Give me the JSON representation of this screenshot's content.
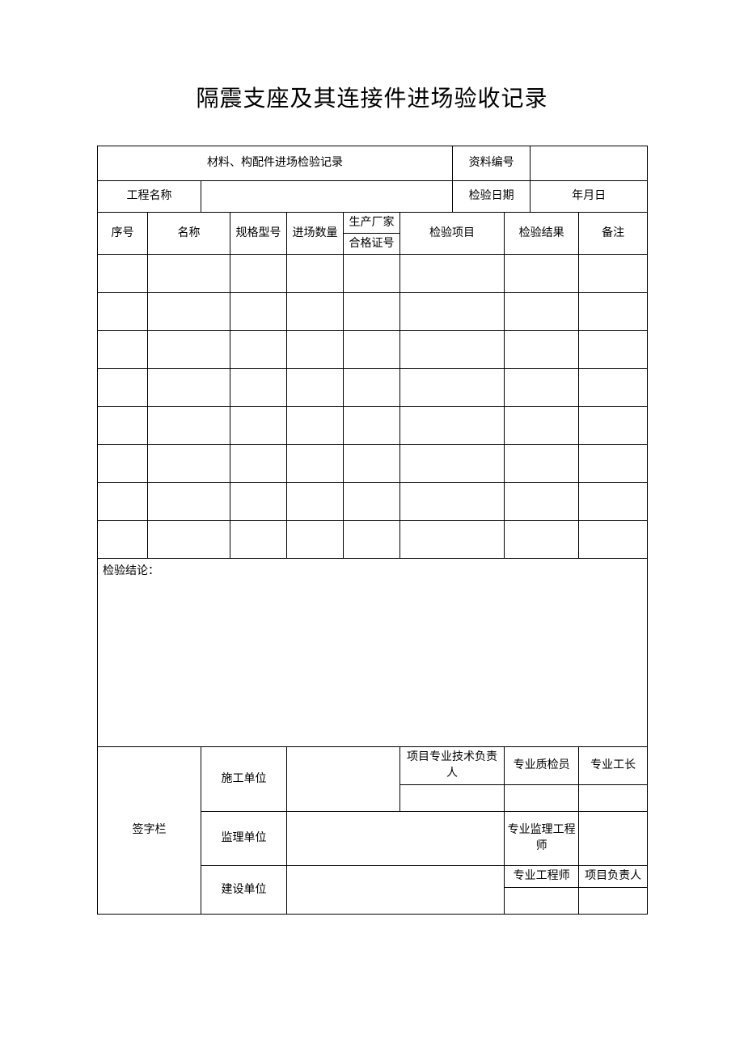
{
  "title": "隔震支座及其连接件进场验收记录",
  "header": {
    "record_title": "材料、构配件进场检验记录",
    "doc_number_label": "资料编号",
    "doc_number_value": ""
  },
  "project_row": {
    "project_name_label": "工程名称",
    "project_name_value": "",
    "check_date_label": "检验日期",
    "check_date_value": "年月日"
  },
  "columns": {
    "seq": "序号",
    "name": "名称",
    "spec": "规格型号",
    "qty": "进场数量",
    "mfr": "生产厂家",
    "cert": "合格证号",
    "item": "检验项目",
    "result": "检验结果",
    "remark": "备注"
  },
  "rows": [
    {
      "seq": "",
      "name": "",
      "spec": "",
      "qty": "",
      "mfr": "",
      "cert": "",
      "item": "",
      "result": "",
      "remark": ""
    },
    {
      "seq": "",
      "name": "",
      "spec": "",
      "qty": "",
      "mfr": "",
      "cert": "",
      "item": "",
      "result": "",
      "remark": ""
    },
    {
      "seq": "",
      "name": "",
      "spec": "",
      "qty": "",
      "mfr": "",
      "cert": "",
      "item": "",
      "result": "",
      "remark": ""
    },
    {
      "seq": "",
      "name": "",
      "spec": "",
      "qty": "",
      "mfr": "",
      "cert": "",
      "item": "",
      "result": "",
      "remark": ""
    },
    {
      "seq": "",
      "name": "",
      "spec": "",
      "qty": "",
      "mfr": "",
      "cert": "",
      "item": "",
      "result": "",
      "remark": ""
    },
    {
      "seq": "",
      "name": "",
      "spec": "",
      "qty": "",
      "mfr": "",
      "cert": "",
      "item": "",
      "result": "",
      "remark": ""
    },
    {
      "seq": "",
      "name": "",
      "spec": "",
      "qty": "",
      "mfr": "",
      "cert": "",
      "item": "",
      "result": "",
      "remark": ""
    },
    {
      "seq": "",
      "name": "",
      "spec": "",
      "qty": "",
      "mfr": "",
      "cert": "",
      "item": "",
      "result": "",
      "remark": ""
    }
  ],
  "conclusion_label": "检验结论：",
  "conclusion_value": "",
  "signature": {
    "section_label": "签字栏",
    "construction_unit": "施工单位",
    "supervision_unit": "监理单位",
    "owner_unit": "建设单位",
    "tech_lead": "项目专业技术负责人",
    "qc_inspector": "专业质检员",
    "foreman": "专业工长",
    "supervision_engineer": "专业监理工程师",
    "pro_engineer": "专业工程师",
    "project_lead": "项目负责人"
  }
}
